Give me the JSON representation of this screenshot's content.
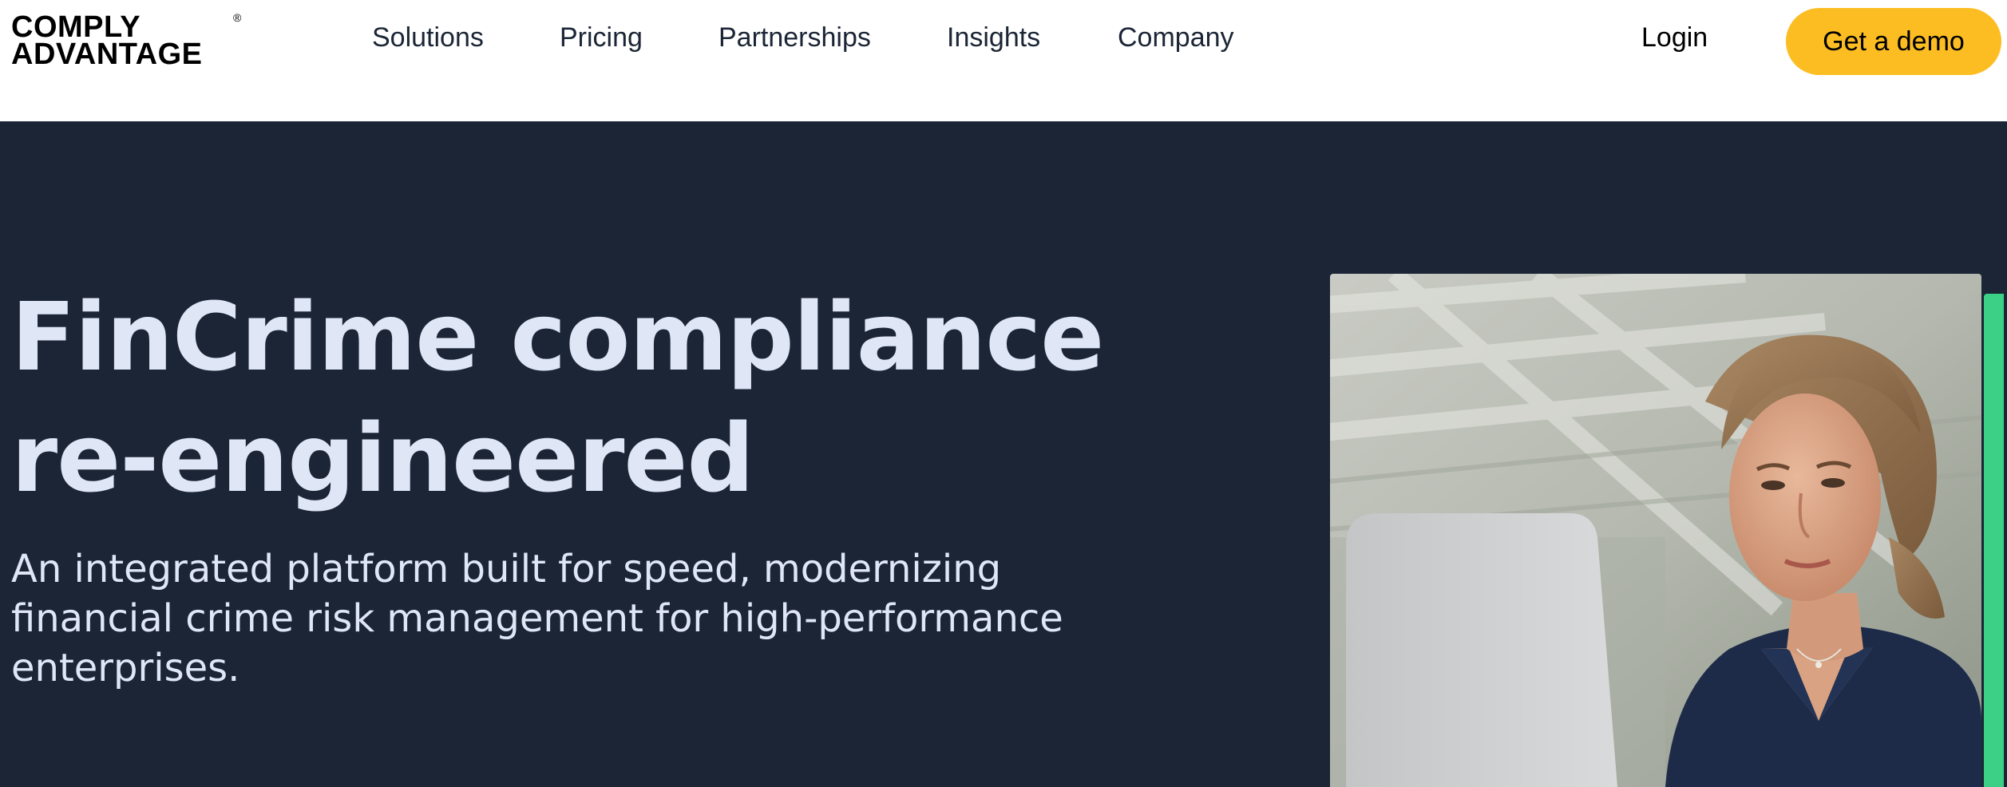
{
  "brand": {
    "logo_line1": "COMPLY",
    "logo_line2": "ADVANTAGE",
    "registered_mark": "®"
  },
  "nav": {
    "items": [
      {
        "label": "Solutions"
      },
      {
        "label": "Pricing"
      },
      {
        "label": "Partnerships"
      },
      {
        "label": "Insights"
      },
      {
        "label": "Company"
      }
    ],
    "login_label": "Login",
    "cta_label": "Get a demo"
  },
  "hero": {
    "title_line1": "FinCrime compliance",
    "title_line2": "re-engineered",
    "subtitle": "An integrated platform built for speed, modernizing financial crime risk management for high-performance enterprises."
  },
  "colors": {
    "header_bg": "#ffffff",
    "hero_bg": "#1b2535",
    "cta_bg": "#fcbd23",
    "accent": "#3ccf86",
    "hero_text": "#dfe7f6"
  },
  "icons": [
    "hero-photo-woman-at-laptop"
  ]
}
